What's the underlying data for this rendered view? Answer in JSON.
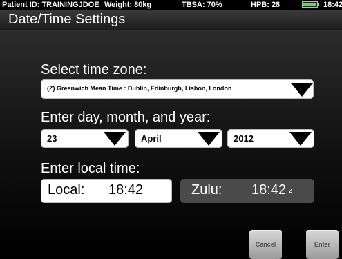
{
  "status": {
    "patient": "Patient ID: TRAININGJDOE",
    "weight": "Weight: 80kg",
    "tbsa": "TBSA: 70%",
    "hpb": "HPB: 28",
    "battery_level": 1.0,
    "battery_color": "#5fd85f",
    "time": "18:42"
  },
  "header": {
    "title": "Date/Time Settings"
  },
  "timezone": {
    "label": "Select time zone:",
    "value": "(Z) Greenwich Mean Time : Dublin, Edinburgh, Lisbon, London"
  },
  "date": {
    "label": "Enter day, month, and year:",
    "day": "23",
    "month": "April",
    "year": "2012"
  },
  "time": {
    "label": "Enter local time:",
    "local_label": "Local:",
    "local_value": "18:42",
    "zulu_label": "Zulu:",
    "zulu_value": "18:42",
    "zulu_suffix": "z"
  },
  "buttons": {
    "cancel": "Cancel",
    "enter": "Enter"
  }
}
